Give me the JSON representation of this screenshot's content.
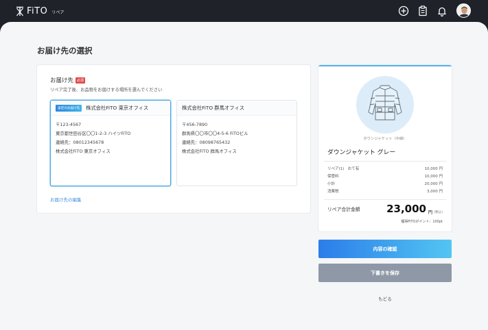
{
  "header": {
    "logo_text": "FiTO",
    "logo_sub": "リペア",
    "icons": [
      "plus-circle-icon",
      "clipboard-icon",
      "bell-icon"
    ]
  },
  "page": {
    "title": "お届け先の選択"
  },
  "destination": {
    "title": "お届け先",
    "required_badge": "必須",
    "description": "リペア完了後、お品物をお届けする場所を選んでください",
    "addresses": [
      {
        "badge": "設定のお届け先",
        "name": "株式会社FiTO 東京オフィス",
        "postal": "〒123-4567",
        "address": "東京都世田谷区〇〇1-2-3 ハイツFiTO",
        "phone": "連絡先：08012345678",
        "recipient": "株式会社FiTO 東京オフィス",
        "selected": true
      },
      {
        "badge": "",
        "name": "株式会社FiTO 群馬オフィス",
        "postal": "〒456-7890",
        "address": "群馬県〇〇市〇〇4-5-6 FiTOビル",
        "phone": "連絡先：08098765432",
        "recipient": "株式会社FiTO 群馬オフィス",
        "selected": false
      }
    ],
    "edit_link": "お届け先の編集"
  },
  "summary": {
    "item_caption": "ダウンジャケット（中綿）",
    "item_name": "ダウンジャケット グレー",
    "fees": [
      {
        "label": "リペア(1)　おて有",
        "value": "10,000 円"
      },
      {
        "label": "保管料",
        "value": "10,000 円"
      },
      {
        "label": "小計",
        "value": "20,000 円"
      },
      {
        "label": "消費税",
        "value": "3,000 円"
      }
    ],
    "total_label": "リペア合計金額",
    "total_amount": "23,000",
    "total_unit": "円",
    "tax_note": "(税込)",
    "points": "獲得FiTOポイント：100pt"
  },
  "actions": {
    "confirm_label": "内容の確認",
    "draft_label": "下書きを保存",
    "back_label": "もどる"
  },
  "colors": {
    "header_bg": "#1f2229",
    "accent": "#2b7de9",
    "accent_light": "#53c5f2",
    "secondary_button": "#8f98a6",
    "required": "#e04a4a"
  }
}
